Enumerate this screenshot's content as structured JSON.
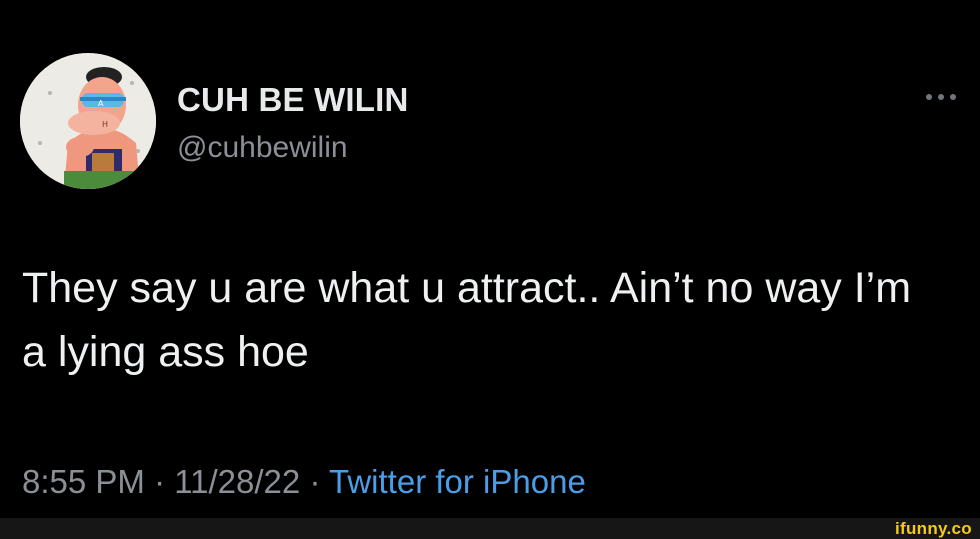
{
  "tweet": {
    "author": {
      "display_name": "CUH BE WILIN",
      "handle": "@cuhbewilin",
      "avatar_icon": "cartoon-character-avatar"
    },
    "more_icon": "more-options-icon",
    "text": "They say u are what u attract.. Ain’t no way I’m a lying ass hoe",
    "meta": {
      "time": "8:55 PM",
      "separator": "·",
      "date": "11/28/22",
      "source": "Twitter for iPhone"
    }
  },
  "watermark": {
    "text": "ifunny.co"
  },
  "colors": {
    "background": "#000000",
    "primary_text": "#e7e9ea",
    "secondary_text": "#8b9096",
    "link": "#4a9ee8",
    "watermark": "#f7c91a"
  }
}
